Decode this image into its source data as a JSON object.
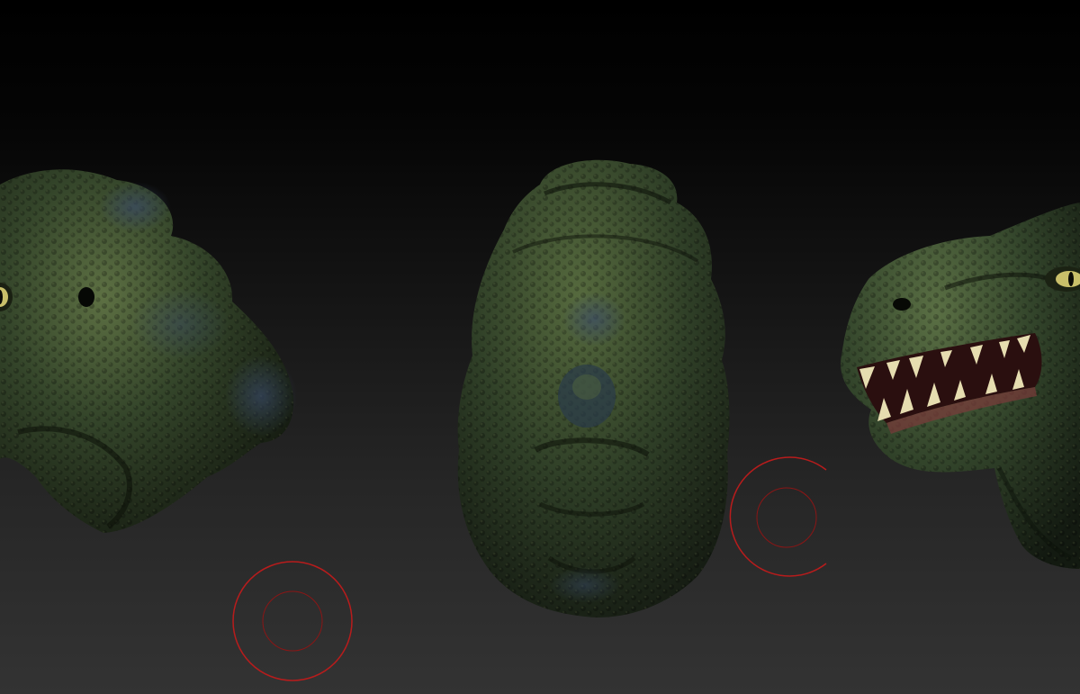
{
  "viewport": {
    "background_top": "#000000",
    "background_bottom": "#333333"
  },
  "model": {
    "skin_color": "#34452a",
    "skin_highlight": "#5d7043",
    "skin_shadow": "#141a10",
    "bump_color": "#2c3a4a",
    "eye_color": "#c9c06a",
    "teeth_color": "#e6ddb0",
    "mouth_color": "#2a0f0f"
  },
  "brush": {
    "cursor_color": "#b81c1c"
  }
}
